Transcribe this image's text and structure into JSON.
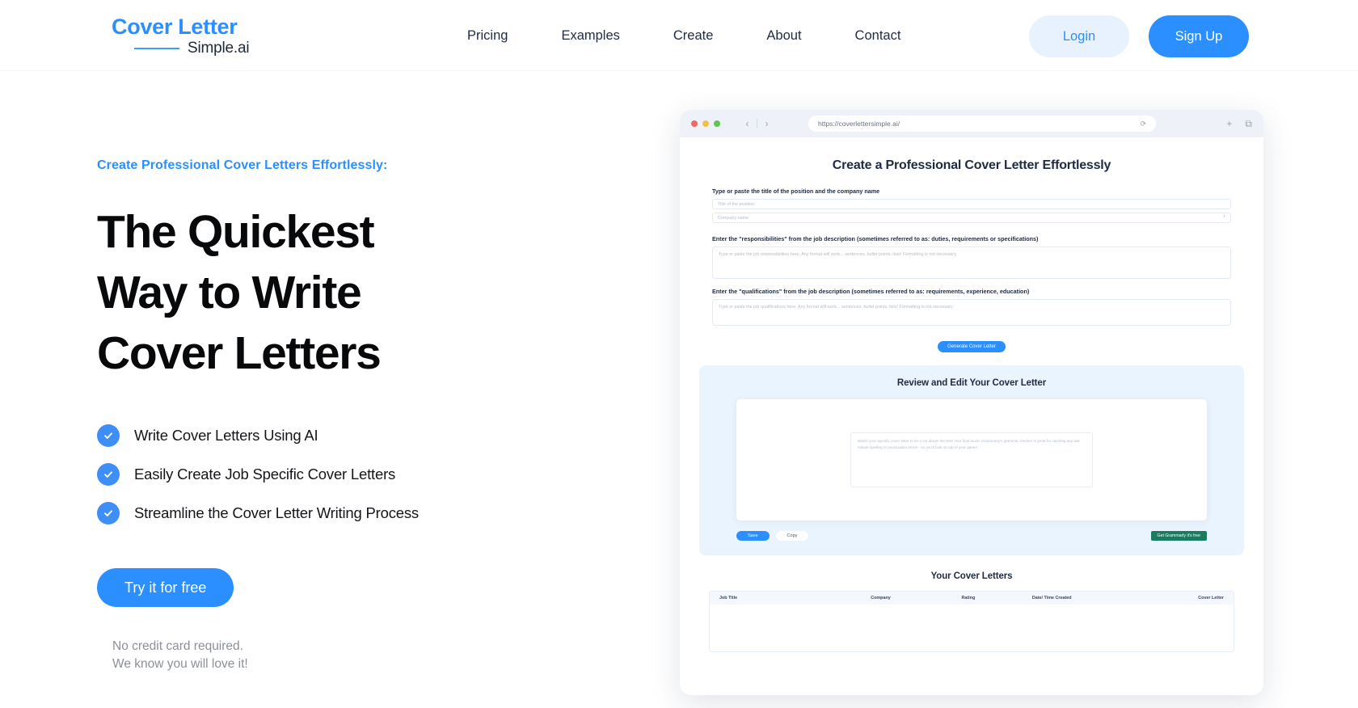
{
  "header": {
    "logo": {
      "top": "Cover Letter",
      "bottom": "Simple.ai"
    },
    "nav": [
      {
        "label": "Pricing"
      },
      {
        "label": "Examples"
      },
      {
        "label": "Create"
      },
      {
        "label": "About"
      },
      {
        "label": "Contact"
      }
    ],
    "login_label": "Login",
    "signup_label": "Sign Up",
    "accent": "#2b8fff",
    "login_bg": "#e8f2fe"
  },
  "hero": {
    "eyebrow": "Create Professional Cover Letters Effortlessly:",
    "headline_line1": "The Quickest",
    "headline_line2": "Way to Write",
    "headline_line3": "Cover Letters",
    "features": [
      {
        "label": "Write Cover Letters Using AI"
      },
      {
        "label": "Easily Create Job Specific Cover Letters"
      },
      {
        "label": "Streamline the Cover Letter Writing Process"
      }
    ],
    "cta_label": "Try it for free",
    "fineprint_line1": "No credit card required.",
    "fineprint_line2": "We know you will love it!"
  },
  "browser": {
    "url": "https://coverlettersimple.ai/",
    "back_glyph": "‹",
    "forward_glyph": "›",
    "reload_glyph": "⟳",
    "new_tab_glyph": "+",
    "tabs_glyph": "⧉"
  },
  "app": {
    "title": "Create a Professional Cover Letter Effortlessly",
    "label_position": "Type or paste the title of the position and the company name",
    "placeholder_title": "Title of the position",
    "placeholder_company": "Company name",
    "label_responsibilities": "Enter the \"responsibilities\" from the job description (sometimes referred to as: duties, requirements or specifications)",
    "placeholder_responsibilities": "Type or paste the job responsibilities here. Any format will work... sentences, bullet points, lists! Formatting is not necessary.",
    "label_qualifications": "Enter the \"qualifications\" from the job description (sometimes referred to as: requirements, experience, education)",
    "placeholder_qualifications": "Type or paste the job qualifications here. Any format will work... sentences, bullet points, lists! Formatting is not necessary.",
    "generate_label": "Generate Cover Letter",
    "review_title": "Review and Edit Your Cover Letter",
    "review_placeholder": "Watch your specific cover letter to be a cut above the rest! Your final touch. Grammarly's grammar checker is great for catching any last minute spelling or punctuation errors - so you'll look on top of your game!",
    "save_label": "Save",
    "copy_label": "Copy",
    "grammarly_label": "Get Grammarly it's free",
    "letters_title": "Your Cover Letters",
    "letters_columns": [
      "Job Title",
      "Company",
      "Rating",
      "Date/ Time Created",
      "Cover Letter"
    ]
  }
}
